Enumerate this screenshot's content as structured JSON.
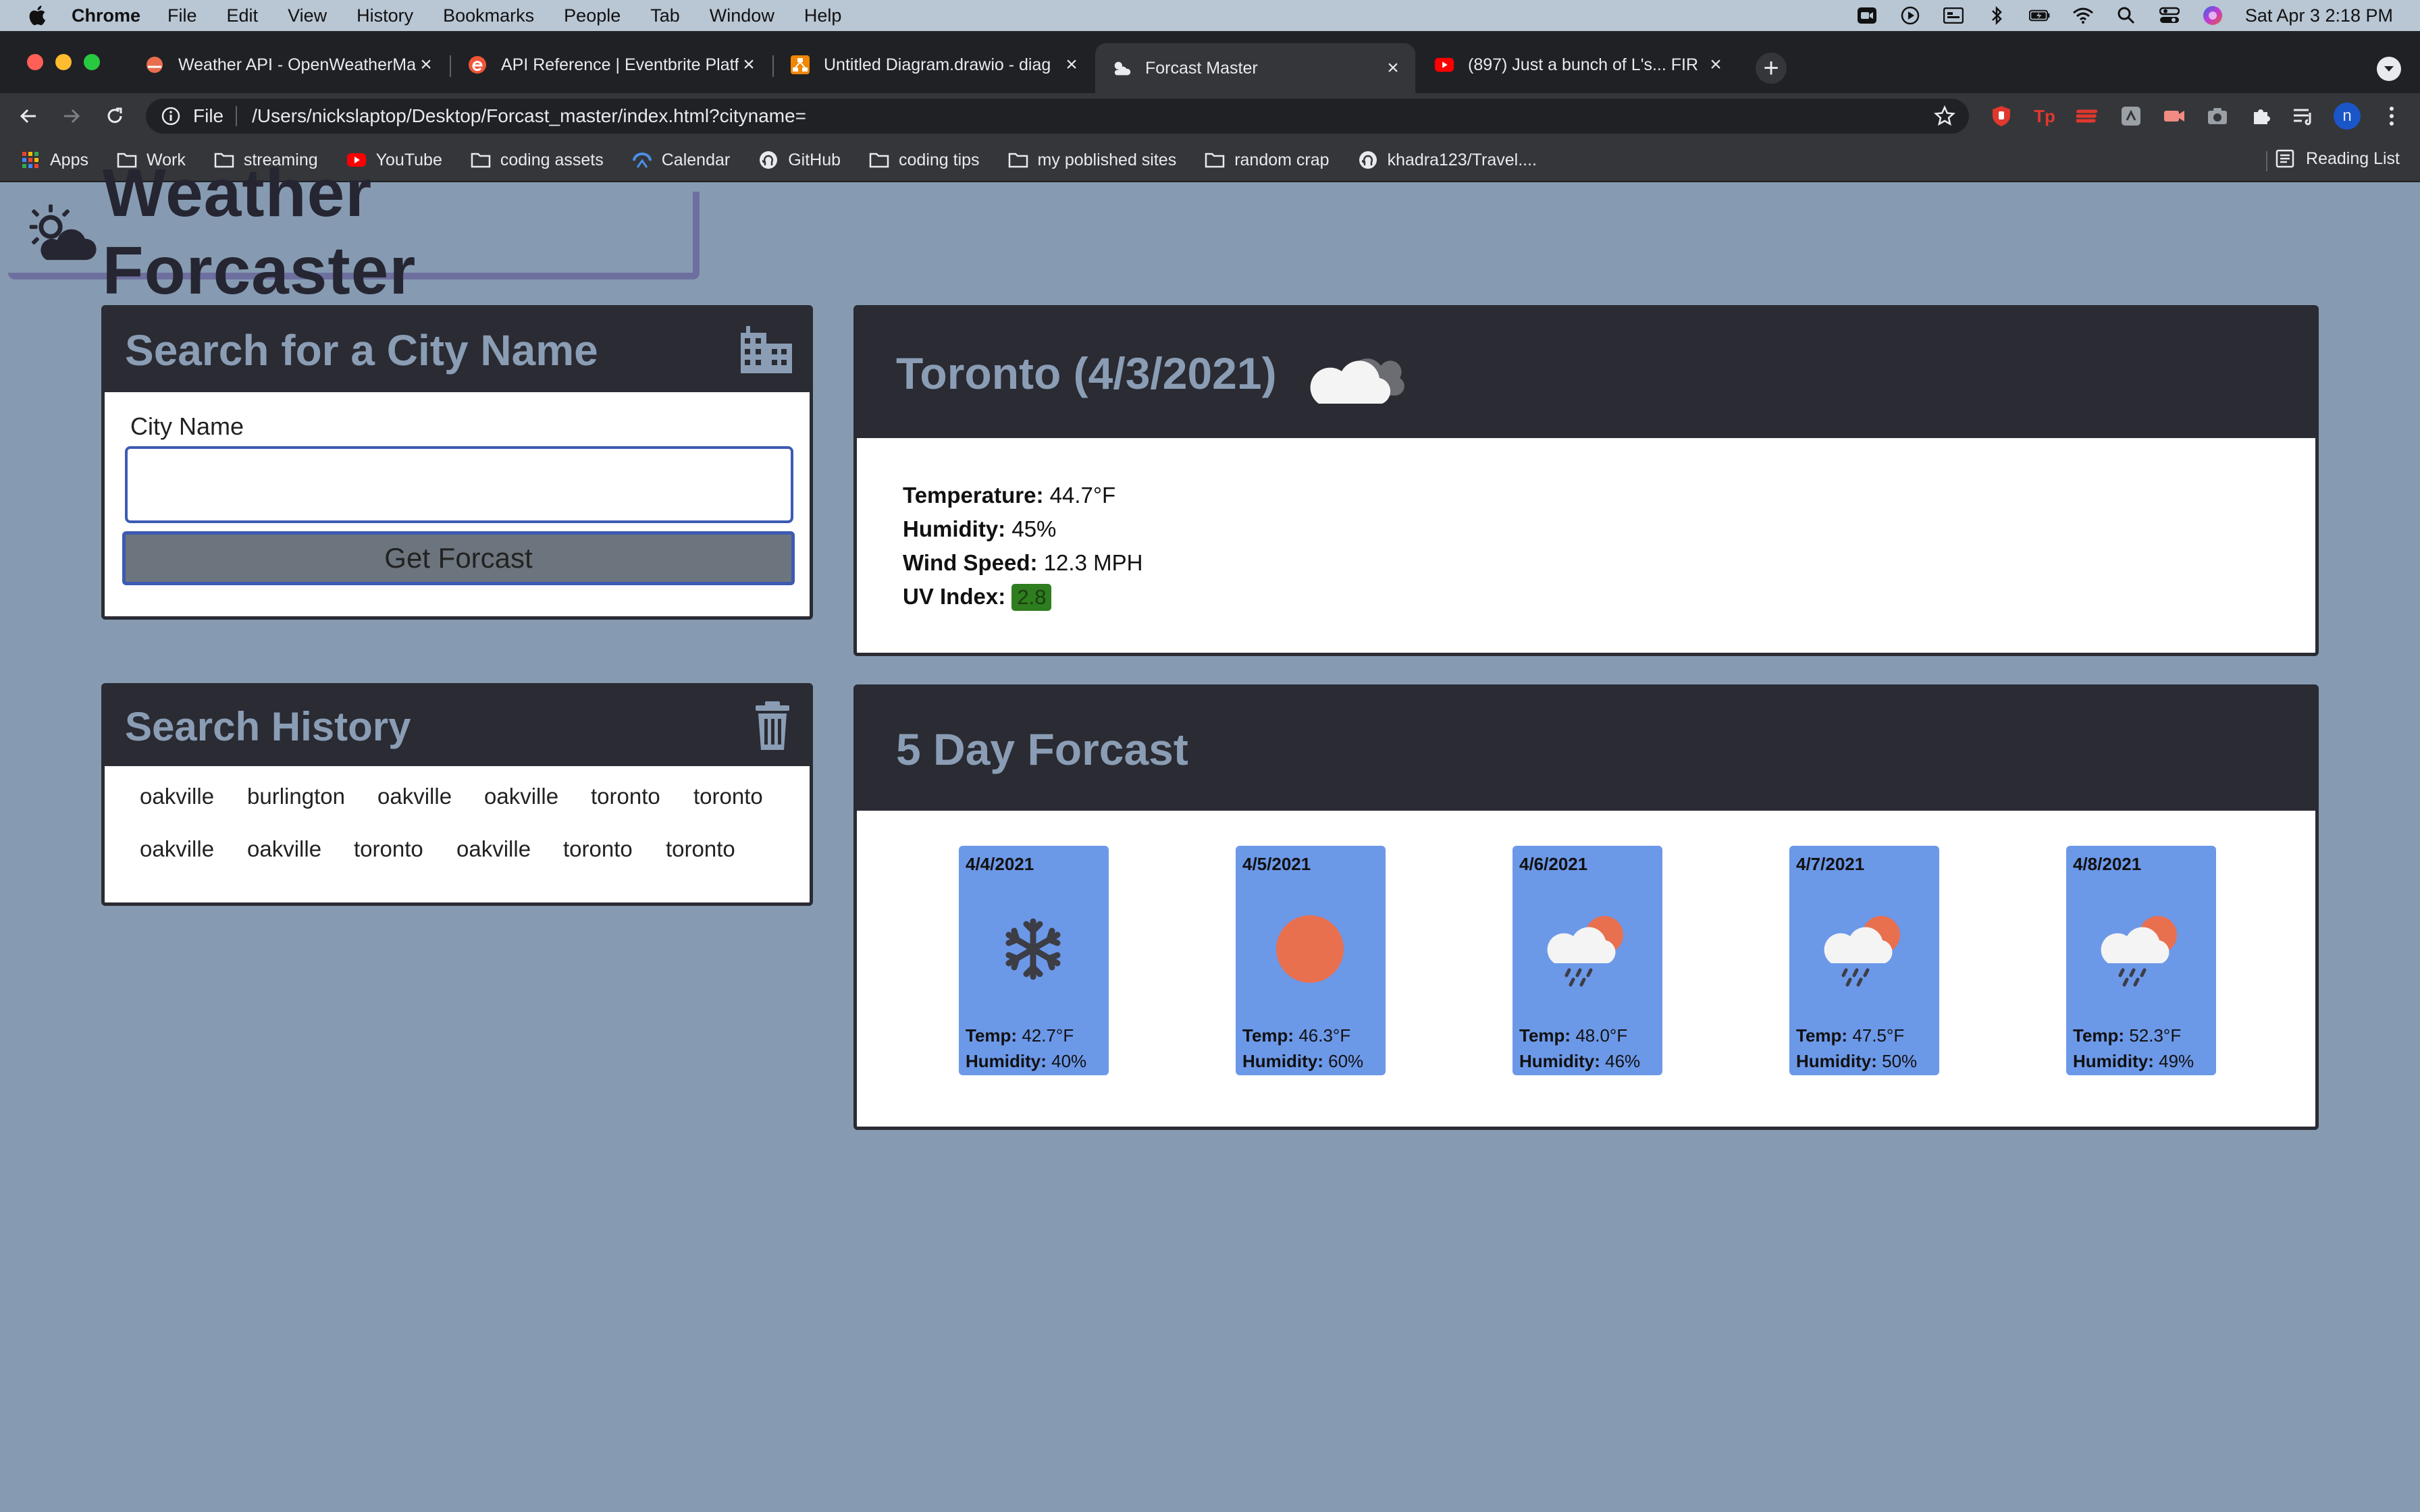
{
  "os_menubar": {
    "app_name": "Chrome",
    "menus": [
      "File",
      "Edit",
      "View",
      "History",
      "Bookmarks",
      "People",
      "Tab",
      "Window",
      "Help"
    ],
    "clock": "Sat Apr 3  2:18 PM"
  },
  "browser": {
    "tabs": [
      {
        "title": "Weather API - OpenWeatherMa",
        "favicon": "openweather-icon"
      },
      {
        "title": "API Reference | Eventbrite Platf",
        "favicon": "eventbrite-icon"
      },
      {
        "title": "Untitled Diagram.drawio - diag",
        "favicon": "drawio-icon"
      },
      {
        "title": "Forcast Master",
        "favicon": "weather-favicon",
        "active": true
      },
      {
        "title": "(897) Just a bunch of L's... FIR",
        "favicon": "youtube-icon"
      }
    ],
    "address": {
      "scheme": "File",
      "url": "/Users/nickslaptop/Desktop/Forcast_master/index.html?cityname="
    },
    "profile_initial": "n",
    "bookmarks": [
      {
        "label": "Apps",
        "icon": "apps-grid-icon"
      },
      {
        "label": "Work",
        "icon": "folder-icon"
      },
      {
        "label": "streaming",
        "icon": "folder-icon"
      },
      {
        "label": "YouTube",
        "icon": "youtube-icon"
      },
      {
        "label": "coding assets",
        "icon": "folder-icon"
      },
      {
        "label": "Calendar",
        "icon": "calendar-icon"
      },
      {
        "label": "GitHub",
        "icon": "github-icon"
      },
      {
        "label": "coding tips",
        "icon": "folder-icon"
      },
      {
        "label": "my poblished sites",
        "icon": "folder-icon"
      },
      {
        "label": "random crap",
        "icon": "folder-icon"
      },
      {
        "label": "khadra123/Travel....",
        "icon": "github-icon"
      }
    ],
    "reading_list": "Reading List"
  },
  "app": {
    "title": "Weather Forcaster",
    "search": {
      "heading": "Search for a City Name",
      "field_label": "City Name",
      "input_value": "",
      "button_label": "Get Forcast"
    },
    "history": {
      "heading": "Search History",
      "items": [
        "oakville",
        "burlington",
        "oakville",
        "oakville",
        "toronto",
        "toronto",
        "oakville",
        "oakville",
        "toronto",
        "oakville",
        "toronto",
        "toronto"
      ]
    },
    "current": {
      "heading": "Toronto (4/3/2021)",
      "icon": "cloud-icon",
      "temp_label": "Temperature:",
      "temp_value": "44.7°F",
      "humidity_label": "Humidity:",
      "humidity_value": "45%",
      "wind_label": "Wind Speed:",
      "wind_value": "12.3 MPH",
      "uv_label": "UV Index:",
      "uv_value": "2.8",
      "uv_color": "#2e7d1e"
    },
    "forecast": {
      "heading": "5 Day Forcast",
      "temp_label": "Temp:",
      "humidity_label": "Humidity:",
      "days": [
        {
          "date": "4/4/2021",
          "icon": "snowflake-icon",
          "temp": "42.7°F",
          "humidity": "40%"
        },
        {
          "date": "4/5/2021",
          "icon": "sun-icon",
          "temp": "46.3°F",
          "humidity": "60%"
        },
        {
          "date": "4/6/2021",
          "icon": "rain-sun-cloud-icon",
          "temp": "48.0°F",
          "humidity": "46%"
        },
        {
          "date": "4/7/2021",
          "icon": "rain-sun-cloud-icon",
          "temp": "47.5°F",
          "humidity": "50%"
        },
        {
          "date": "4/8/2021",
          "icon": "rain-sun-cloud-icon",
          "temp": "52.3°F",
          "humidity": "49%"
        }
      ]
    }
  },
  "colors": {
    "page_bg": "#869bb1",
    "panel_header": "#2a2b33",
    "header_text": "#8a9db4",
    "card_bg": "#6c98e8",
    "sun": "#e8704f"
  }
}
